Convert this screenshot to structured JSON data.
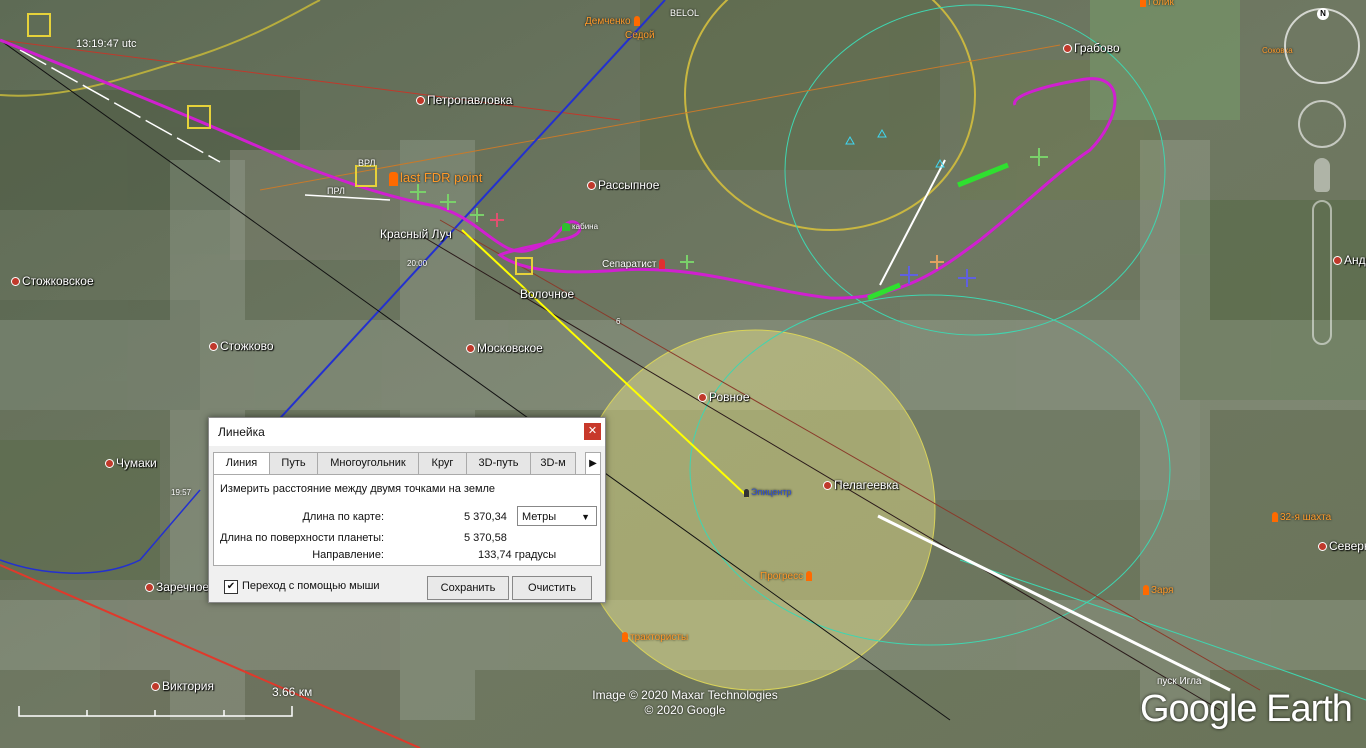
{
  "map": {
    "places": [
      {
        "name": "Петропавловка"
      },
      {
        "name": "Рассыпное"
      },
      {
        "name": "Грабово"
      },
      {
        "name": "Стожковское"
      },
      {
        "name": "Стожково"
      },
      {
        "name": "Московское"
      },
      {
        "name": "Ровное"
      },
      {
        "name": "Пелагеевка"
      },
      {
        "name": "Чумаки"
      },
      {
        "name": "Заречное"
      },
      {
        "name": "Виктория"
      },
      {
        "name": "Северн"
      },
      {
        "name": "Андр"
      }
    ],
    "labels": {
      "krasny_luch": "Красный Луч",
      "volochnoe": "Волочное",
      "last_fdr": "last FDR point",
      "separatist": "Сепаратист",
      "kabina": "кабина",
      "epicenter": "Эпицентр",
      "progress": "Прогресс",
      "traktoristy": "трактористы",
      "shakhta": "32-я шахта",
      "zarya": "Заря",
      "pusk_igla": "пуск Игла",
      "demchenko": "Демченко",
      "sedoy": "Седой",
      "belol": "BELOL",
      "golik": "Голик",
      "sokovka": "Соковка",
      "vrl": "ВРЛ",
      "prl": "ПРЛ",
      "time1": "13:19:47 utc",
      "time2": "20:00",
      "time3": "19:57",
      "point6": "6"
    }
  },
  "ruler": {
    "title": "Линейка",
    "tabs": [
      "Линия",
      "Путь",
      "Многоугольник",
      "Круг",
      "3D-путь",
      "3D-м"
    ],
    "active_tab": "Линия",
    "description": "Измерить расстояние между двумя точками на земле",
    "map_length_label": "Длина по карте:",
    "map_length_value": "5 370,34",
    "unit": "Метры",
    "ground_length_label": "Длина по поверхности планеты:",
    "ground_length_value": "5 370,58",
    "heading_label": "Направление:",
    "heading_value": "133,74 градусы",
    "mouse_nav_label": "Переход с помощью мыши",
    "mouse_nav_checked": true,
    "save_label": "Сохранить",
    "clear_label": "Очистить"
  },
  "nav": {
    "north_label": "N"
  },
  "scale": {
    "label": "3.66 км"
  },
  "copyright": {
    "line1": "Image © 2020 Maxar Technologies",
    "line2": "© 2020 Google"
  },
  "logo": {
    "text": "Google Earth"
  }
}
